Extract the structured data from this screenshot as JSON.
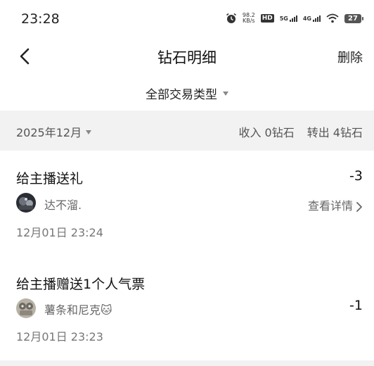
{
  "status_bar": {
    "time": "23:28",
    "speed_value": "98.2",
    "speed_unit": "KB/s",
    "hd_label": "HD",
    "network_1": "5G",
    "network_2": "4G",
    "battery": "27"
  },
  "header": {
    "title": "钻石明细",
    "delete_label": "删除"
  },
  "filter": {
    "label": "全部交易类型"
  },
  "summary": {
    "month": "2025年12月",
    "income": "收入 0钻石",
    "expense": "转出 4钻石"
  },
  "transactions": [
    {
      "title": "给主播送礼",
      "amount": "-3",
      "user": "达不溜.",
      "details_label": "查看详情",
      "time": "12月01日 23:24"
    },
    {
      "title": "给主播赠送1个人气票",
      "amount": "-1",
      "user": "薯条和尼克🐱",
      "time": "12月01日 23:23"
    }
  ]
}
